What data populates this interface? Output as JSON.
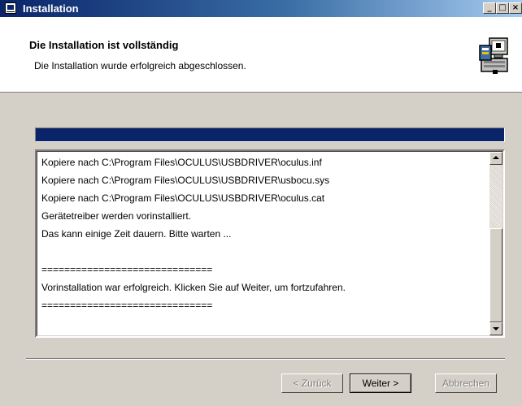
{
  "window": {
    "title": "Installation",
    "controls": [
      "minimize",
      "maximize",
      "close"
    ]
  },
  "header": {
    "title": "Die Installation ist vollständig",
    "subtitle": "Die Installation wurde erfolgreich abgeschlossen.",
    "icon": "installer-computer-icon"
  },
  "progress": {
    "fraction": 1.0
  },
  "log": {
    "lines": [
      "Kopiere nach C:\\Program Files\\OCULUS\\USBDRIVER\\oculus.inf",
      "Kopiere nach C:\\Program Files\\OCULUS\\USBDRIVER\\usbocu.sys",
      "Kopiere nach C:\\Program Files\\OCULUS\\USBDRIVER\\oculus.cat",
      "Gerätetreiber werden vorinstalliert.",
      "Das kann einige Zeit dauern. Bitte warten ...",
      "",
      "==============================",
      "Vorinstallation war erfolgreich. Klicken Sie auf Weiter, um fortzufahren.",
      "=============================="
    ],
    "scroll_position": 1.0
  },
  "buttons": {
    "back": "< Zurück",
    "next": "Weiter >",
    "cancel": "Abbrechen"
  },
  "colors": {
    "title_bar_start": "#0a246a",
    "title_bar_end": "#a6caf0",
    "progress_fill": "#0a246a",
    "dialog_bg": "#d4d0c8"
  }
}
